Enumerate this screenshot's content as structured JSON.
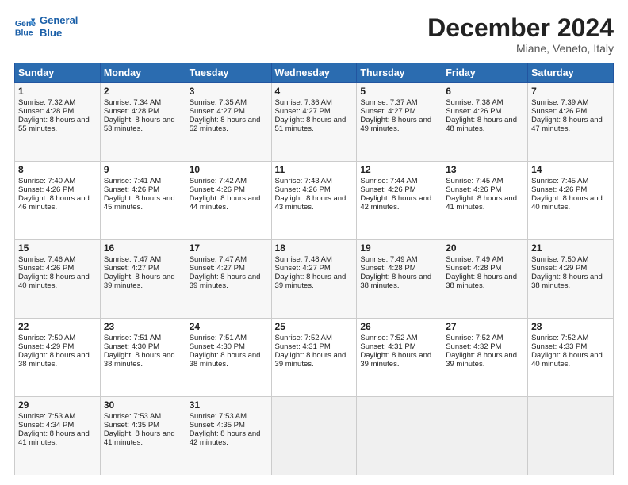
{
  "logo": {
    "line1": "General",
    "line2": "Blue"
  },
  "header": {
    "title": "December 2024",
    "location": "Miane, Veneto, Italy"
  },
  "weekdays": [
    "Sunday",
    "Monday",
    "Tuesday",
    "Wednesday",
    "Thursday",
    "Friday",
    "Saturday"
  ],
  "weeks": [
    [
      {
        "day": "1",
        "sunrise": "Sunrise: 7:32 AM",
        "sunset": "Sunset: 4:28 PM",
        "daylight": "Daylight: 8 hours and 55 minutes."
      },
      {
        "day": "2",
        "sunrise": "Sunrise: 7:34 AM",
        "sunset": "Sunset: 4:28 PM",
        "daylight": "Daylight: 8 hours and 53 minutes."
      },
      {
        "day": "3",
        "sunrise": "Sunrise: 7:35 AM",
        "sunset": "Sunset: 4:27 PM",
        "daylight": "Daylight: 8 hours and 52 minutes."
      },
      {
        "day": "4",
        "sunrise": "Sunrise: 7:36 AM",
        "sunset": "Sunset: 4:27 PM",
        "daylight": "Daylight: 8 hours and 51 minutes."
      },
      {
        "day": "5",
        "sunrise": "Sunrise: 7:37 AM",
        "sunset": "Sunset: 4:27 PM",
        "daylight": "Daylight: 8 hours and 49 minutes."
      },
      {
        "day": "6",
        "sunrise": "Sunrise: 7:38 AM",
        "sunset": "Sunset: 4:26 PM",
        "daylight": "Daylight: 8 hours and 48 minutes."
      },
      {
        "day": "7",
        "sunrise": "Sunrise: 7:39 AM",
        "sunset": "Sunset: 4:26 PM",
        "daylight": "Daylight: 8 hours and 47 minutes."
      }
    ],
    [
      {
        "day": "8",
        "sunrise": "Sunrise: 7:40 AM",
        "sunset": "Sunset: 4:26 PM",
        "daylight": "Daylight: 8 hours and 46 minutes."
      },
      {
        "day": "9",
        "sunrise": "Sunrise: 7:41 AM",
        "sunset": "Sunset: 4:26 PM",
        "daylight": "Daylight: 8 hours and 45 minutes."
      },
      {
        "day": "10",
        "sunrise": "Sunrise: 7:42 AM",
        "sunset": "Sunset: 4:26 PM",
        "daylight": "Daylight: 8 hours and 44 minutes."
      },
      {
        "day": "11",
        "sunrise": "Sunrise: 7:43 AM",
        "sunset": "Sunset: 4:26 PM",
        "daylight": "Daylight: 8 hours and 43 minutes."
      },
      {
        "day": "12",
        "sunrise": "Sunrise: 7:44 AM",
        "sunset": "Sunset: 4:26 PM",
        "daylight": "Daylight: 8 hours and 42 minutes."
      },
      {
        "day": "13",
        "sunrise": "Sunrise: 7:45 AM",
        "sunset": "Sunset: 4:26 PM",
        "daylight": "Daylight: 8 hours and 41 minutes."
      },
      {
        "day": "14",
        "sunrise": "Sunrise: 7:45 AM",
        "sunset": "Sunset: 4:26 PM",
        "daylight": "Daylight: 8 hours and 40 minutes."
      }
    ],
    [
      {
        "day": "15",
        "sunrise": "Sunrise: 7:46 AM",
        "sunset": "Sunset: 4:26 PM",
        "daylight": "Daylight: 8 hours and 40 minutes."
      },
      {
        "day": "16",
        "sunrise": "Sunrise: 7:47 AM",
        "sunset": "Sunset: 4:27 PM",
        "daylight": "Daylight: 8 hours and 39 minutes."
      },
      {
        "day": "17",
        "sunrise": "Sunrise: 7:47 AM",
        "sunset": "Sunset: 4:27 PM",
        "daylight": "Daylight: 8 hours and 39 minutes."
      },
      {
        "day": "18",
        "sunrise": "Sunrise: 7:48 AM",
        "sunset": "Sunset: 4:27 PM",
        "daylight": "Daylight: 8 hours and 39 minutes."
      },
      {
        "day": "19",
        "sunrise": "Sunrise: 7:49 AM",
        "sunset": "Sunset: 4:28 PM",
        "daylight": "Daylight: 8 hours and 38 minutes."
      },
      {
        "day": "20",
        "sunrise": "Sunrise: 7:49 AM",
        "sunset": "Sunset: 4:28 PM",
        "daylight": "Daylight: 8 hours and 38 minutes."
      },
      {
        "day": "21",
        "sunrise": "Sunrise: 7:50 AM",
        "sunset": "Sunset: 4:29 PM",
        "daylight": "Daylight: 8 hours and 38 minutes."
      }
    ],
    [
      {
        "day": "22",
        "sunrise": "Sunrise: 7:50 AM",
        "sunset": "Sunset: 4:29 PM",
        "daylight": "Daylight: 8 hours and 38 minutes."
      },
      {
        "day": "23",
        "sunrise": "Sunrise: 7:51 AM",
        "sunset": "Sunset: 4:30 PM",
        "daylight": "Daylight: 8 hours and 38 minutes."
      },
      {
        "day": "24",
        "sunrise": "Sunrise: 7:51 AM",
        "sunset": "Sunset: 4:30 PM",
        "daylight": "Daylight: 8 hours and 38 minutes."
      },
      {
        "day": "25",
        "sunrise": "Sunrise: 7:52 AM",
        "sunset": "Sunset: 4:31 PM",
        "daylight": "Daylight: 8 hours and 39 minutes."
      },
      {
        "day": "26",
        "sunrise": "Sunrise: 7:52 AM",
        "sunset": "Sunset: 4:31 PM",
        "daylight": "Daylight: 8 hours and 39 minutes."
      },
      {
        "day": "27",
        "sunrise": "Sunrise: 7:52 AM",
        "sunset": "Sunset: 4:32 PM",
        "daylight": "Daylight: 8 hours and 39 minutes."
      },
      {
        "day": "28",
        "sunrise": "Sunrise: 7:52 AM",
        "sunset": "Sunset: 4:33 PM",
        "daylight": "Daylight: 8 hours and 40 minutes."
      }
    ],
    [
      {
        "day": "29",
        "sunrise": "Sunrise: 7:53 AM",
        "sunset": "Sunset: 4:34 PM",
        "daylight": "Daylight: 8 hours and 41 minutes."
      },
      {
        "day": "30",
        "sunrise": "Sunrise: 7:53 AM",
        "sunset": "Sunset: 4:35 PM",
        "daylight": "Daylight: 8 hours and 41 minutes."
      },
      {
        "day": "31",
        "sunrise": "Sunrise: 7:53 AM",
        "sunset": "Sunset: 4:35 PM",
        "daylight": "Daylight: 8 hours and 42 minutes."
      },
      null,
      null,
      null,
      null
    ]
  ]
}
